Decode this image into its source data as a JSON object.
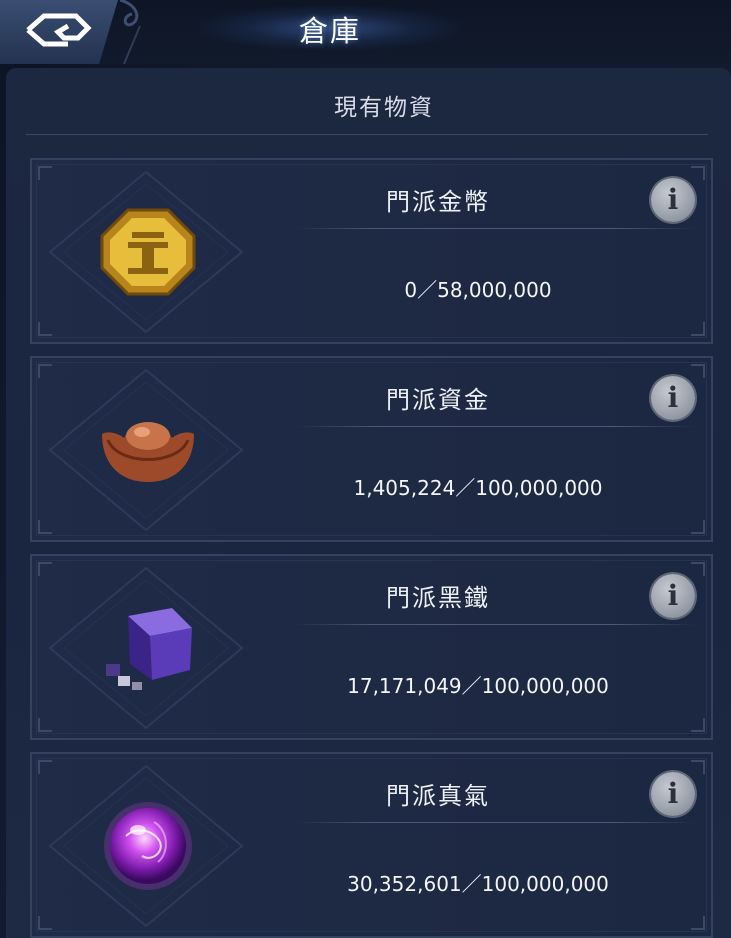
{
  "header": {
    "title": "倉庫"
  },
  "section": {
    "title": "現有物資"
  },
  "resources": [
    {
      "name": "門派金幣",
      "amount": "0／58,000,000",
      "icon": "gold-coin-icon"
    },
    {
      "name": "門派資金",
      "amount": "1,405,224／100,000,000",
      "icon": "copper-ingot-icon"
    },
    {
      "name": "門派黑鐵",
      "amount": "17,171,049／100,000,000",
      "icon": "black-iron-cube-icon"
    },
    {
      "name": "門派真氣",
      "amount": "30,352,601／100,000,000",
      "icon": "purple-qi-orb-icon"
    }
  ],
  "info_glyph": "i",
  "colors": {
    "background": "#16203a",
    "card_border": "#34425f",
    "text": "#eef1f7",
    "gold": "#e0b63a",
    "copper": "#a8552e",
    "iron": "#5a3ca8",
    "qi": "#c040e0"
  }
}
